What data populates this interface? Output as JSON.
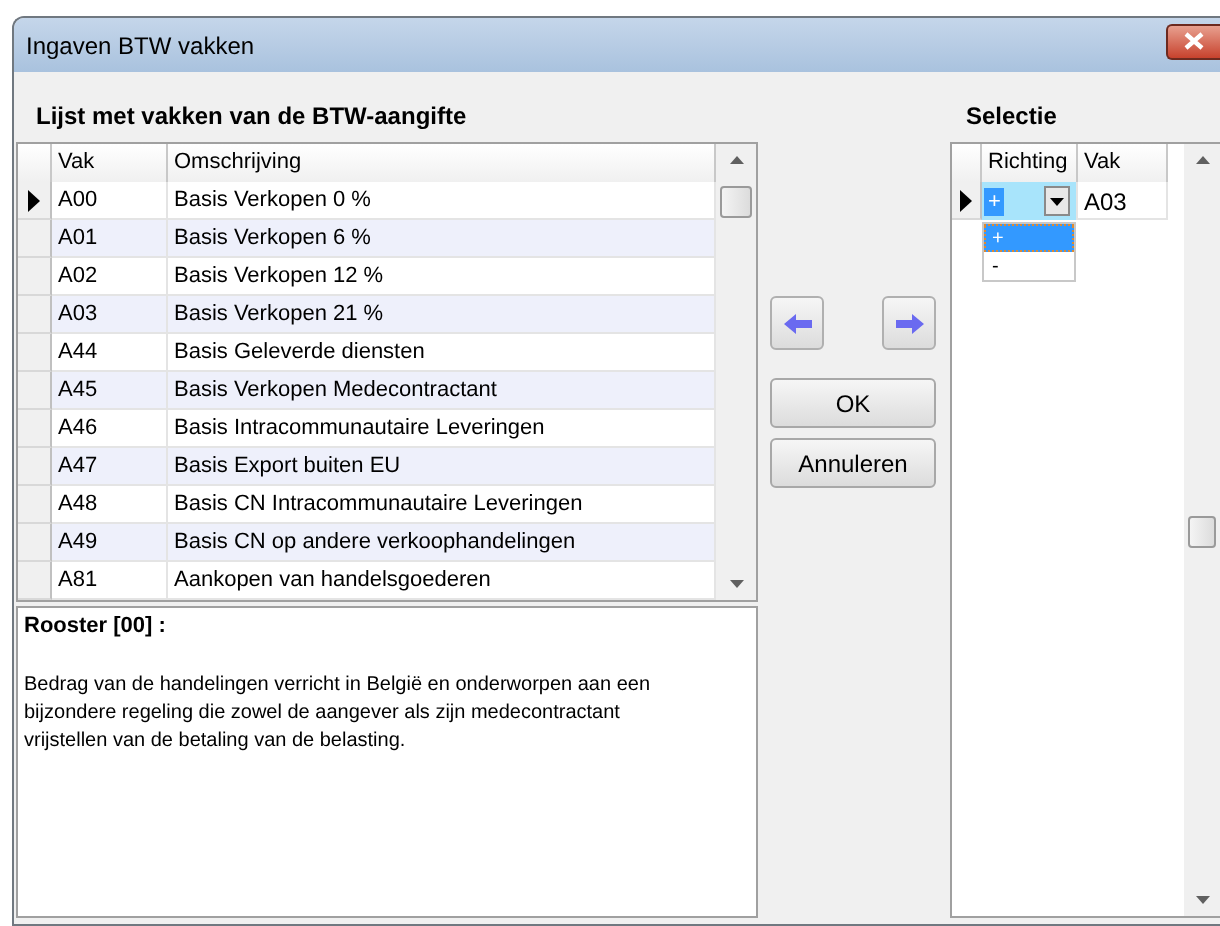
{
  "window": {
    "title": "Ingaven BTW vakken"
  },
  "list": {
    "heading": "Lijst met vakken van de BTW-aangifte",
    "columns": [
      "Vak",
      "Omschrijving"
    ],
    "rows": [
      {
        "vak": "A00",
        "omschrijving": "Basis Verkopen 0 %",
        "current": true
      },
      {
        "vak": "A01",
        "omschrijving": "Basis  Verkopen 6 %",
        "current": false
      },
      {
        "vak": "A02",
        "omschrijving": "Basis Verkopen 12 %",
        "current": false
      },
      {
        "vak": "A03",
        "omschrijving": "Basis Verkopen 21 %",
        "current": false
      },
      {
        "vak": "A44",
        "omschrijving": "Basis Geleverde diensten",
        "current": false
      },
      {
        "vak": "A45",
        "omschrijving": "Basis Verkopen Medecontractant",
        "current": false
      },
      {
        "vak": "A46",
        "omschrijving": "Basis Intracommunautaire Leveringen",
        "current": false
      },
      {
        "vak": "A47",
        "omschrijving": "Basis Export buiten EU",
        "current": false
      },
      {
        "vak": "A48",
        "omschrijving": "Basis CN Intracommunautaire Leveringen",
        "current": false
      },
      {
        "vak": "A49",
        "omschrijving": "Basis CN op andere verkoophandelingen",
        "current": false
      },
      {
        "vak": "A81",
        "omschrijving": "Aankopen van handelsgoederen",
        "current": false
      }
    ]
  },
  "description": {
    "title": "Rooster [00] :",
    "text": "Bedrag van de handelingen verricht in België en onderworpen aan een bijzondere regeling die zowel de aangever als zijn medecontractant vrijstellen van de betaling van de belasting."
  },
  "buttons": {
    "ok": "OK",
    "cancel": "Annuleren"
  },
  "selection": {
    "heading": "Selectie",
    "columns": [
      "Richting",
      "Vak"
    ],
    "rows": [
      {
        "richting": "+",
        "vak": "A03",
        "current": true
      }
    ],
    "dropdown": {
      "options": [
        {
          "label": "+",
          "selected": true
        },
        {
          "label": "-",
          "selected": false
        }
      ]
    }
  }
}
